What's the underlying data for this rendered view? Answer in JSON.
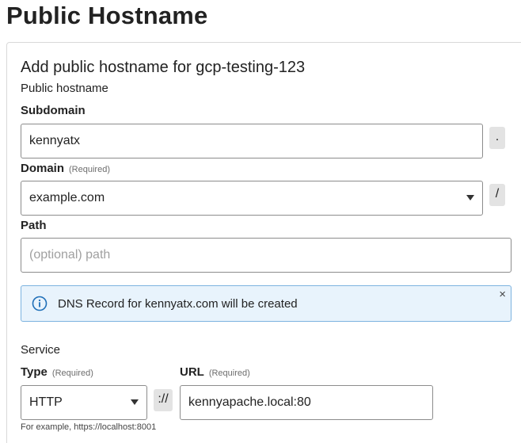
{
  "page": {
    "title": "Public Hostname"
  },
  "card": {
    "title": "Add public hostname for gcp-testing-123",
    "hostname_section": "Public hostname",
    "subdomain": {
      "label": "Subdomain",
      "value": "kennyatx",
      "separator": "."
    },
    "domain": {
      "label": "Domain",
      "required": "(Required)",
      "value": "example.com",
      "separator": "/"
    },
    "path": {
      "label": "Path",
      "placeholder": "(optional) path"
    },
    "alert": {
      "text": "DNS Record for kennyatx.com will be created",
      "close": "×"
    },
    "service_section": "Service",
    "type": {
      "label": "Type",
      "required": "(Required)",
      "value": "HTTP",
      "separator": "://"
    },
    "url": {
      "label": "URL",
      "required": "(Required)",
      "value": "kennyapache.local:80",
      "hint": "For example, https://localhost:8001"
    }
  },
  "colors": {
    "alert_background": "#e8f3fc",
    "alert_border": "#7db3e0",
    "info_icon": "#1f6fb8",
    "input_border": "#8c8c8c"
  },
  "icons": {
    "alert": "info-circle-icon",
    "close": "close-icon",
    "select": "caret-down-icon"
  }
}
